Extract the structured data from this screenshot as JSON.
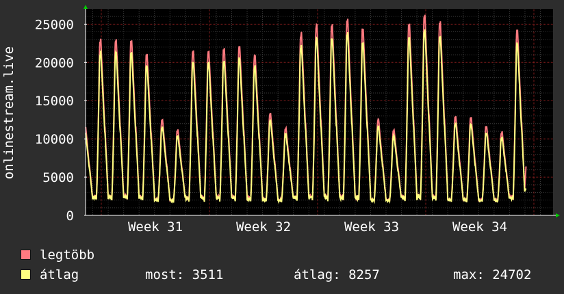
{
  "chart_data": {
    "type": "line",
    "ylabel": "onlinestream.live",
    "xlabel": "",
    "ylim": [
      0,
      27000
    ],
    "yticks": [
      0,
      5000,
      10000,
      15000,
      20000,
      25000
    ],
    "ytick_labels": [
      "0",
      "5000",
      "10000",
      "15000",
      "20000",
      "25000"
    ],
    "x_ticks": [
      "Week 31",
      "Week 32",
      "Week 33",
      "Week 34"
    ],
    "grid": true,
    "day_ranges": [
      [
        1700,
        11800
      ],
      [
        1800,
        22700
      ],
      [
        1700,
        22700
      ],
      [
        1800,
        22600
      ],
      [
        1800,
        20800
      ],
      [
        1700,
        12300
      ],
      [
        1700,
        11000
      ],
      [
        1700,
        21200
      ],
      [
        1700,
        21200
      ],
      [
        1700,
        21500
      ],
      [
        1700,
        21800
      ],
      [
        1700,
        20700
      ],
      [
        1700,
        13200
      ],
      [
        1700,
        11200
      ],
      [
        1700,
        23700
      ],
      [
        1700,
        24600
      ],
      [
        1700,
        24600
      ],
      [
        1700,
        25300
      ],
      [
        1700,
        24000
      ],
      [
        1700,
        12300
      ],
      [
        1700,
        11000
      ],
      [
        1700,
        24700
      ],
      [
        1700,
        25900
      ],
      [
        1700,
        25000
      ],
      [
        1700,
        12700
      ],
      [
        1700,
        12600
      ],
      [
        1700,
        11500
      ],
      [
        1700,
        10800
      ],
      [
        1700,
        23900
      ]
    ],
    "current_end": 6400,
    "series": [
      {
        "name": "legtöbb",
        "color": "#ff7a80"
      },
      {
        "name": "átlag",
        "color": "#ffff80"
      }
    ]
  },
  "legend": {
    "max_label": "legtöbb",
    "avg_label": "átlag"
  },
  "stats": {
    "now": "most: 3511",
    "avg": "átlag: 8257",
    "max": "max: 24702"
  },
  "colors": {
    "background": "#2d2d2d",
    "plot_bg": "#000000",
    "grid_major": "#8b1e1e",
    "grid_minor": "#3a3a3a",
    "axis": "#ffffff",
    "arrow": "#00cc00"
  }
}
